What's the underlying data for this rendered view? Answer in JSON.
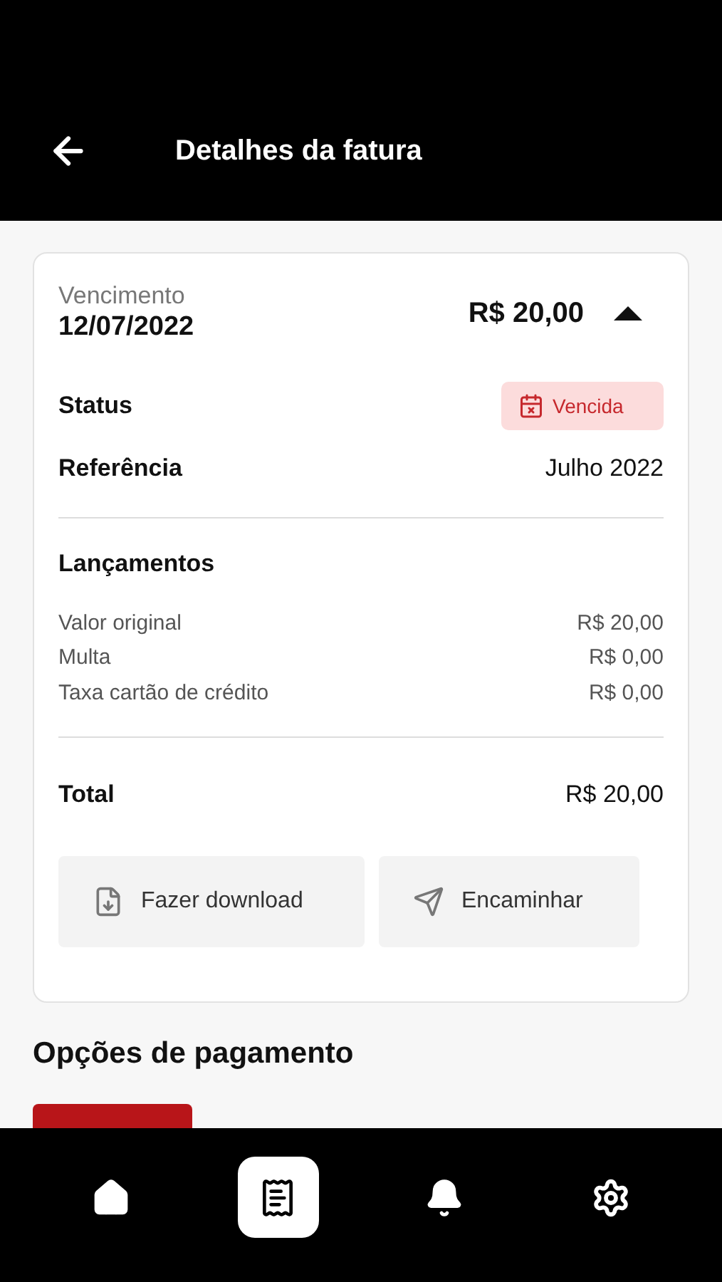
{
  "header": {
    "title": "Detalhes da fatura"
  },
  "invoice": {
    "due_label": "Vencimento",
    "due_date": "12/07/2022",
    "amount": "R$ 20,00",
    "expanded": true,
    "status": {
      "label": "Status",
      "value": "Vencida"
    },
    "reference": {
      "label": "Referência",
      "value": "Julho 2022"
    },
    "entries": {
      "title": "Lançamentos",
      "items": [
        {
          "label": "Valor original",
          "value": "R$ 20,00"
        },
        {
          "label": "Multa",
          "value": "R$ 0,00"
        },
        {
          "label": "Taxa cartão de crédito",
          "value": "R$ 0,00"
        }
      ]
    },
    "total": {
      "label": "Total",
      "value": "R$ 20,00"
    },
    "actions": [
      {
        "kind": "download",
        "label": "Fazer download"
      },
      {
        "kind": "forward",
        "label": "Encaminhar"
      }
    ]
  },
  "payment": {
    "title": "Opções de pagamento"
  },
  "nav": [
    {
      "kind": "home",
      "selected": false
    },
    {
      "kind": "invoice",
      "selected": true
    },
    {
      "kind": "bell",
      "selected": false
    },
    {
      "kind": "gear",
      "selected": false
    }
  ]
}
